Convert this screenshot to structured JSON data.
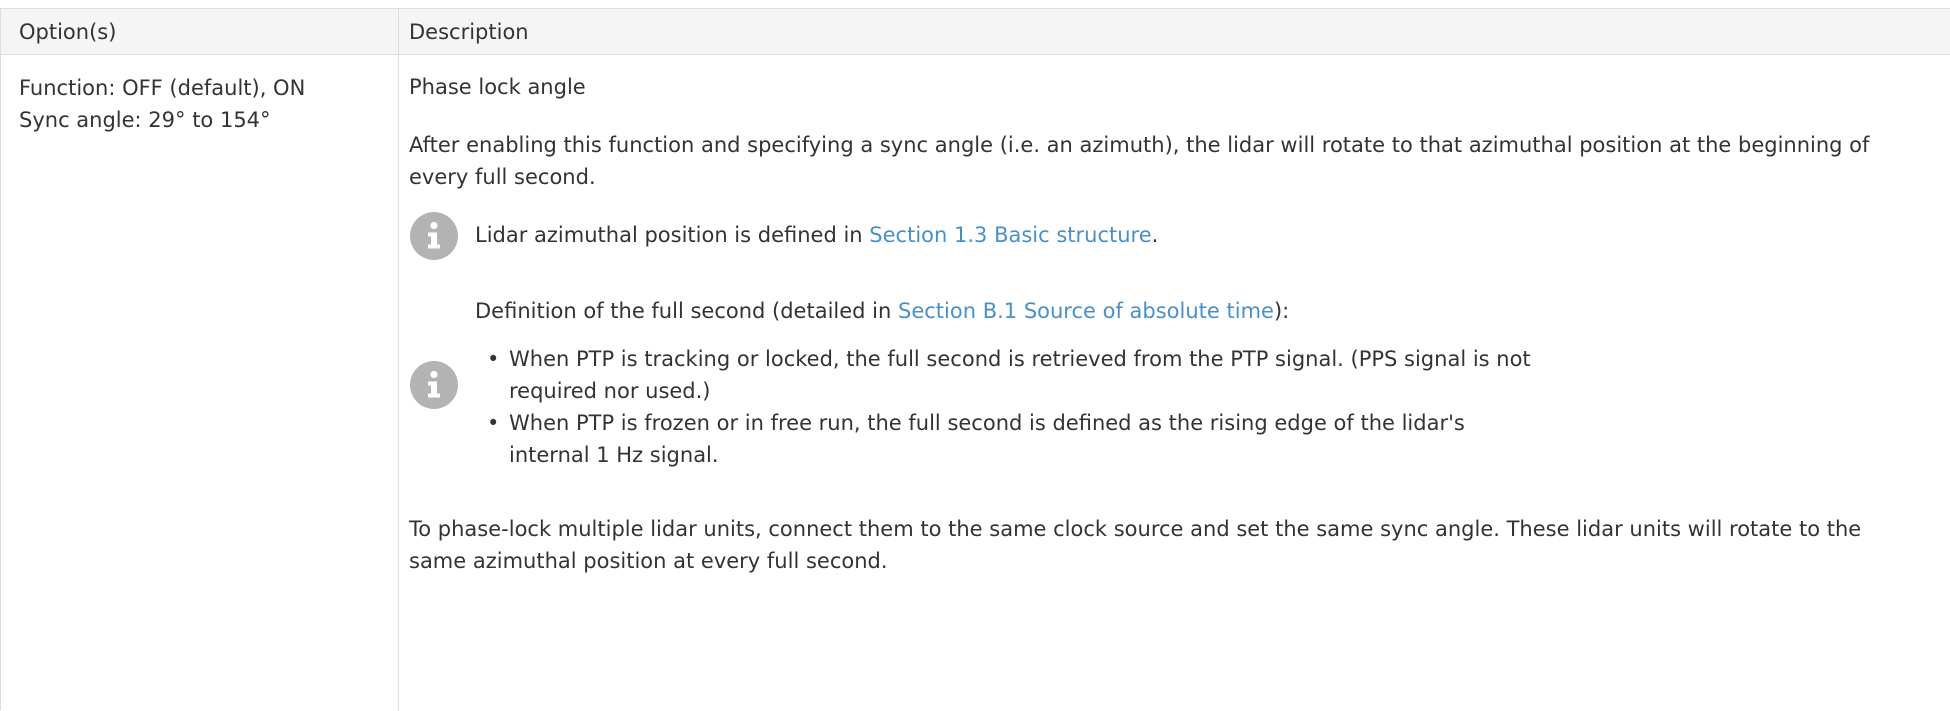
{
  "table": {
    "header": {
      "option_label": "Option(s)",
      "description_label": "Description"
    },
    "row": {
      "options": [
        "Function: OFF (default), ON",
        "Sync angle: 29° to 154°"
      ],
      "title": "Phase lock angle",
      "para1": "After enabling this function and specifying a sync angle (i.e. an azimuth), the lidar will rotate to that azimuthal position at the beginning of every full second.",
      "note1": {
        "icon": "info-icon",
        "prefix": "Lidar azimuthal position is defined in ",
        "link": "Section 1.3 Basic structure",
        "suffix": "."
      },
      "note2": {
        "icon": "info-icon",
        "intro_prefix": "Definition of the full second (detailed in ",
        "intro_link": "Section B.1 Source of absolute time",
        "intro_suffix": "):",
        "bullet_marker": "•",
        "bullets": [
          "When PTP is tracking or locked, the full second is retrieved from the PTP signal. (PPS signal is not required nor used.)",
          "When PTP is frozen or in free run, the full second is defined as the rising edge of the lidar's internal 1 Hz signal."
        ]
      },
      "para2": "To phase-lock multiple lidar units, connect them to the same clock source and set the same sync angle. These lidar units will rotate to the same azimuthal position at every full second."
    }
  },
  "colors": {
    "text": "#333333",
    "link": "#4a90c8",
    "border": "#dddddd",
    "header_bg": "#f5f5f5",
    "icon_bg": "#b3b3b3"
  }
}
